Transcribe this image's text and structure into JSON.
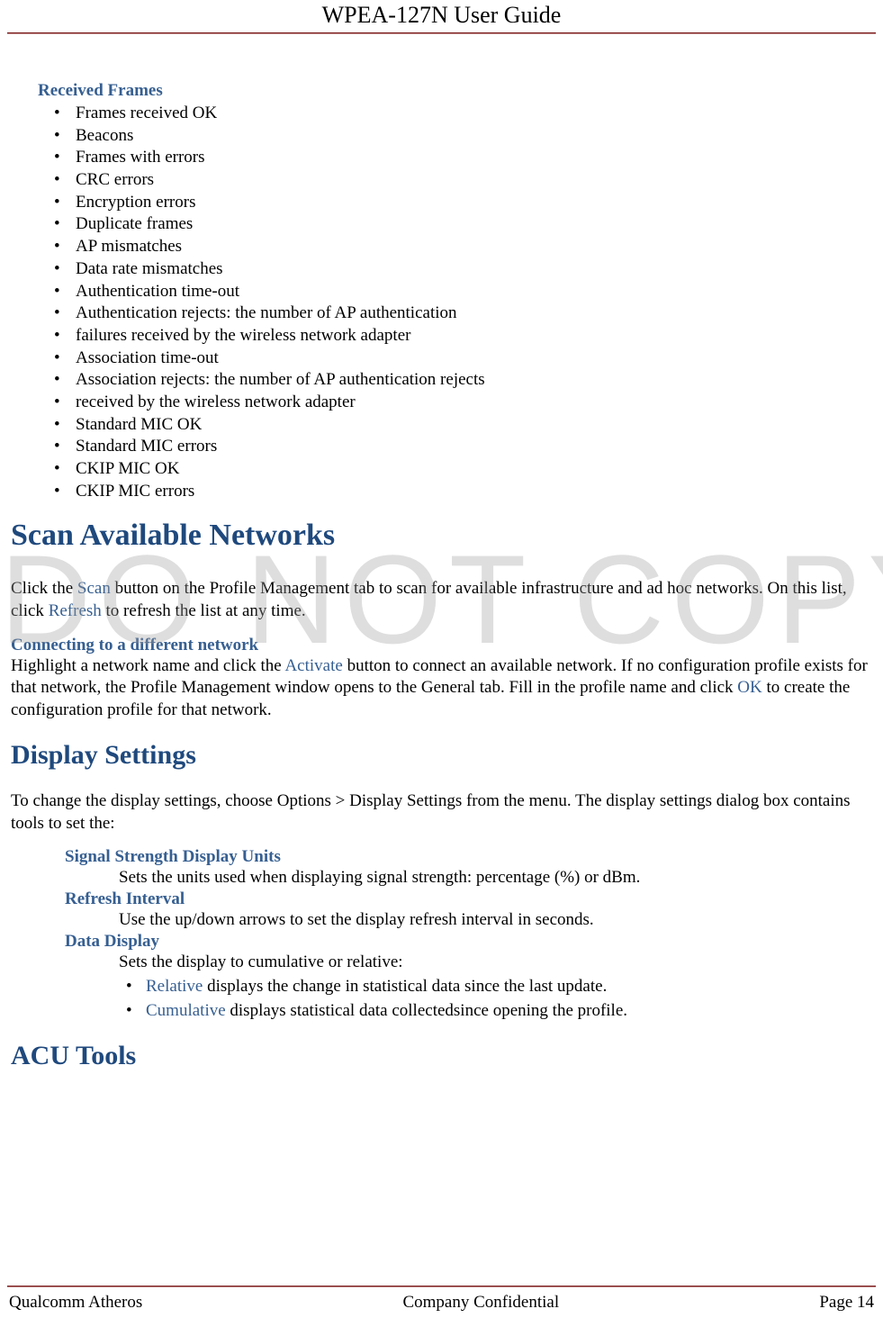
{
  "header": {
    "title": "WPEA-127N User Guide"
  },
  "footer": {
    "left": "Qualcomm Atheros",
    "center": "Company Confidential",
    "right": "Page 14"
  },
  "watermark": "DO NOT COPY",
  "received": {
    "heading": "Received Frames",
    "items": [
      "Frames received OK",
      "Beacons",
      "Frames with errors",
      "CRC errors",
      "Encryption errors",
      "Duplicate frames",
      "AP mismatches",
      "Data rate mismatches",
      "Authentication time-out",
      "Authentication rejects: the number of AP authentication",
      "failures received by the wireless network adapter",
      "Association time-out",
      "Association rejects: the number of AP authentication rejects",
      "received by the wireless network adapter",
      "Standard MIC OK",
      "Standard MIC errors",
      "CKIP MIC OK",
      "CKIP MIC errors"
    ]
  },
  "scan": {
    "heading": "Scan Available Networks",
    "p1a": "Click the ",
    "p1_link1": "Scan",
    "p1b": " button on the Profile Management tab to scan for available infrastructure and ad hoc networks. On this list, click ",
    "p1_link2": "Refresh",
    "p1c": " to refresh the list at any time.",
    "sub1": "Connecting to a different network",
    "p2a": "Highlight a network name and click the ",
    "p2_link1": "Activate",
    "p2b": " button to connect an available network. If no configuration profile exists for that network, the Profile Management window opens to the General tab. Fill in the profile name and click ",
    "p2_link2": "OK",
    "p2c": " to create the configuration profile for that network."
  },
  "display": {
    "heading": "Display Settings",
    "intro": "To change the display settings, choose Options > Display Settings from the menu. The display settings dialog box contains tools to set the:",
    "s1": "Signal Strength Display Units",
    "s1_desc": "Sets the units used when displaying signal strength: percentage (%) or dBm.",
    "s2": "Refresh Interval",
    "s2_desc": "Use the up/down arrows to set the display refresh interval in seconds.",
    "s3": "Data Display",
    "s3_intro": "Sets the display to cumulative or relative:",
    "b1_link": "Relative",
    "b1_rest": " displays the change in statistical data since the last update.",
    "b2_link": "Cumulative",
    "b2_rest": " displays statistical data collectedsince opening the profile."
  },
  "acu": {
    "heading": "ACU Tools"
  }
}
